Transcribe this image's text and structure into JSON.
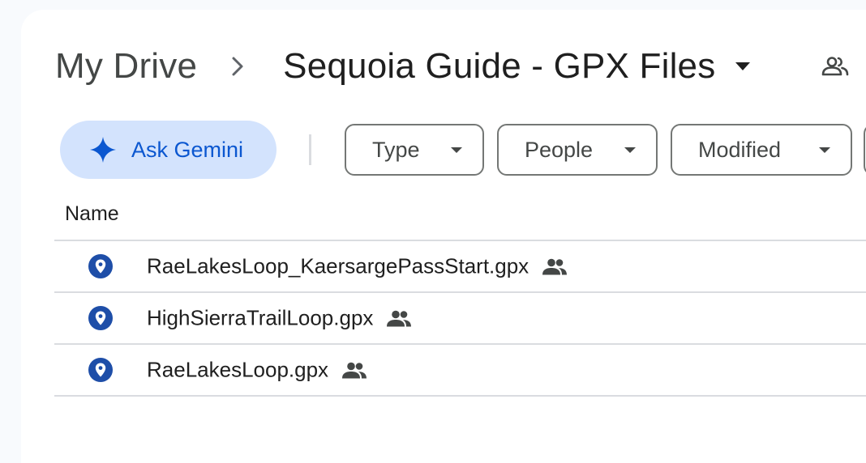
{
  "breadcrumb": {
    "root": "My Drive",
    "current": "Sequoia Guide - GPX Files"
  },
  "icons": {
    "separator": "chevron-right-icon",
    "folder_menu": "caret-down-icon",
    "shared_folder": "people-icon",
    "gemini": "sparkle-icon",
    "file_type": "map-pin-icon"
  },
  "colors": {
    "gemini_bg": "#d3e3fd",
    "gemini_text": "#0b57d0",
    "map_icon": "#1e4ea8"
  },
  "toolbar": {
    "ask_gemini": "Ask Gemini",
    "filters": [
      {
        "label": "Type"
      },
      {
        "label": "People"
      },
      {
        "label": "Modified"
      }
    ]
  },
  "table": {
    "column_name": "Name",
    "files": [
      {
        "name": "RaeLakesLoop_KaersargePassStart.gpx",
        "shared": true
      },
      {
        "name": "HighSierraTrailLoop.gpx",
        "shared": true
      },
      {
        "name": "RaeLakesLoop.gpx",
        "shared": true
      }
    ]
  }
}
